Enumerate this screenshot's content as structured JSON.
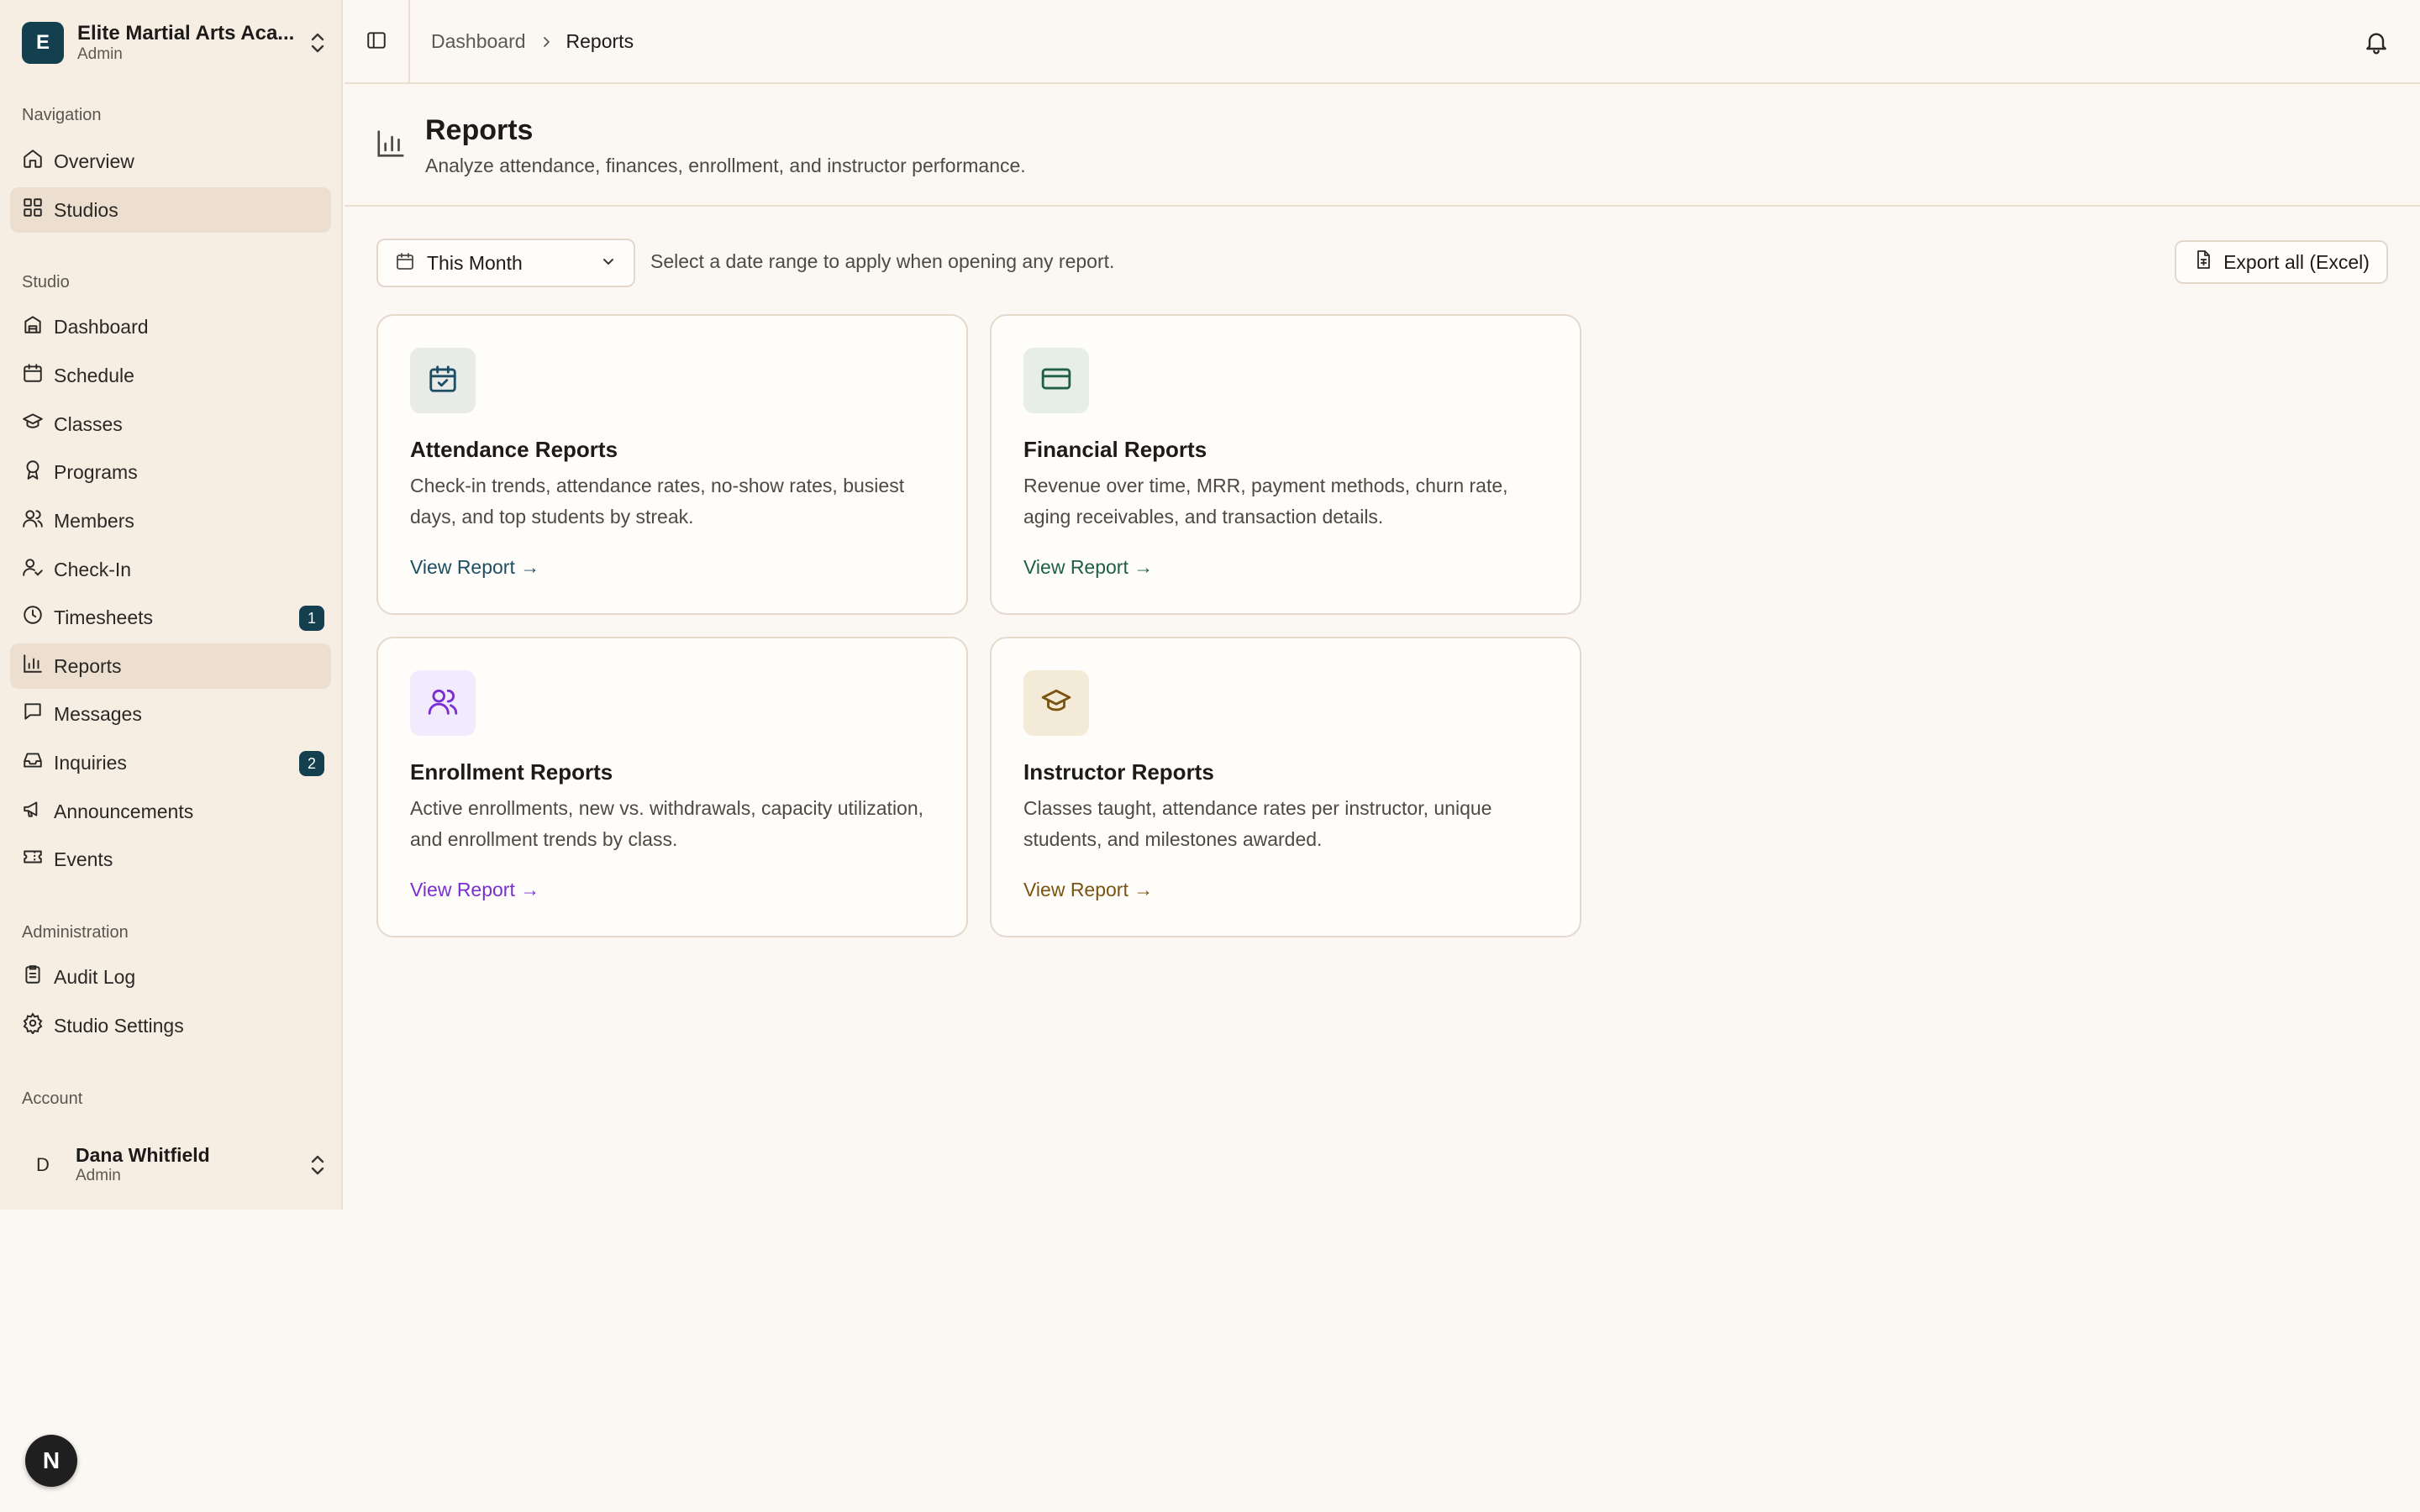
{
  "org": {
    "initial": "E",
    "name": "Elite Martial Arts Aca...",
    "role": "Admin"
  },
  "sidebar": {
    "navigation_label": "Navigation",
    "navigation": [
      {
        "label": "Overview",
        "icon": "home-icon"
      },
      {
        "label": "Studios",
        "icon": "grid-icon",
        "active": true
      }
    ],
    "studio_label": "Studio",
    "studio": [
      {
        "label": "Dashboard",
        "icon": "dashboard-icon"
      },
      {
        "label": "Schedule",
        "icon": "calendar-icon"
      },
      {
        "label": "Classes",
        "icon": "graduation-cap-icon"
      },
      {
        "label": "Programs",
        "icon": "award-icon"
      },
      {
        "label": "Members",
        "icon": "users-icon"
      },
      {
        "label": "Check-In",
        "icon": "user-check-icon"
      },
      {
        "label": "Timesheets",
        "icon": "clock-icon",
        "badge": "1"
      },
      {
        "label": "Reports",
        "icon": "bar-chart-icon",
        "active": true
      },
      {
        "label": "Messages",
        "icon": "message-icon"
      },
      {
        "label": "Inquiries",
        "icon": "inbox-icon",
        "badge": "2"
      },
      {
        "label": "Announcements",
        "icon": "megaphone-icon"
      },
      {
        "label": "Events",
        "icon": "ticket-icon"
      }
    ],
    "admin_label": "Administration",
    "admin": [
      {
        "label": "Audit Log",
        "icon": "clipboard-icon"
      },
      {
        "label": "Studio Settings",
        "icon": "gear-icon"
      }
    ],
    "account_label": "Account"
  },
  "user": {
    "initial": "D",
    "name": "Dana Whitfield",
    "role": "Admin"
  },
  "breadcrumb": [
    "Dashboard",
    "Reports"
  ],
  "page": {
    "title": "Reports",
    "subtitle": "Analyze attendance, finances, enrollment, and instructor performance."
  },
  "controls": {
    "date_range": "This Month",
    "date_hint": "Select a date range to apply when opening any report.",
    "export_label": "Export all (Excel)"
  },
  "cards": [
    {
      "title": "Attendance Reports",
      "description": "Check-in trends, attendance rates, no-show rates, busiest days, and top students by streak.",
      "link": "View Report →",
      "icon": "calendar-check-icon",
      "accent": "#1d4e63",
      "icon_bg": "#e8ebe8"
    },
    {
      "title": "Financial Reports",
      "description": "Revenue over time, MRR, payment methods, churn rate, aging receivables, and transaction details.",
      "link": "View Report →",
      "icon": "credit-card-icon",
      "accent": "#1f5f47",
      "icon_bg": "#e7ede7"
    },
    {
      "title": "Enrollment Reports",
      "description": "Active enrollments, new vs. withdrawals, capacity utilization, and enrollment trends by class.",
      "link": "View Report →",
      "icon": "users-icon",
      "accent": "#7a2fd0",
      "icon_bg": "#f2eafd"
    },
    {
      "title": "Instructor Reports",
      "description": "Classes taught, attendance rates per instructor, unique students, and milestones awarded.",
      "link": "View Report →",
      "icon": "graduation-cap-icon",
      "accent": "#7a5410",
      "icon_bg": "#f4ead8"
    }
  ],
  "floating": {
    "label": "N"
  }
}
